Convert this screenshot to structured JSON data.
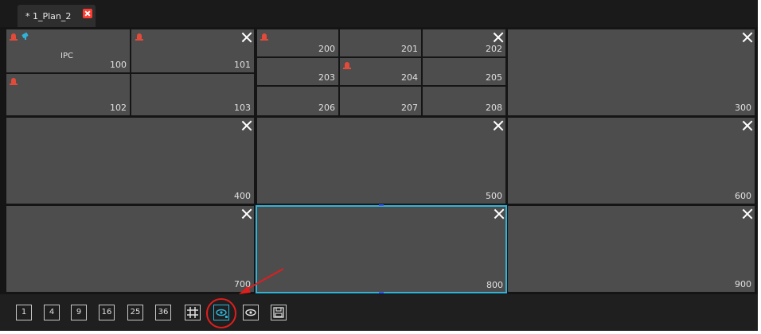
{
  "tab": {
    "label": "* 1_Plan_2"
  },
  "panes_small": [
    {
      "label": "100"
    },
    {
      "label": "101"
    },
    {
      "label": "102"
    },
    {
      "label": "103"
    },
    {
      "label": "200"
    },
    {
      "label": "201"
    },
    {
      "label": "202"
    },
    {
      "label": "203"
    },
    {
      "label": "204"
    },
    {
      "label": "205"
    },
    {
      "label": "206"
    },
    {
      "label": "207"
    },
    {
      "label": "208"
    }
  ],
  "ipc_label": "IPC",
  "panes_big": [
    {
      "label": "300"
    },
    {
      "label": "400"
    },
    {
      "label": "500"
    },
    {
      "label": "600"
    },
    {
      "label": "700"
    },
    {
      "label": "800"
    },
    {
      "label": "900"
    }
  ],
  "toolbar": {
    "layouts": [
      "1",
      "4",
      "9",
      "16",
      "25",
      "36"
    ]
  },
  "colors": {
    "accent": "#2fb4d8",
    "alarm": "#e24a3a",
    "annotation": "#e01e1e"
  },
  "icons": [
    "grid-icon",
    "eye-settings-icon",
    "eye-icon",
    "save-icon",
    "close-icon",
    "alarm-icon",
    "camera-icon"
  ]
}
